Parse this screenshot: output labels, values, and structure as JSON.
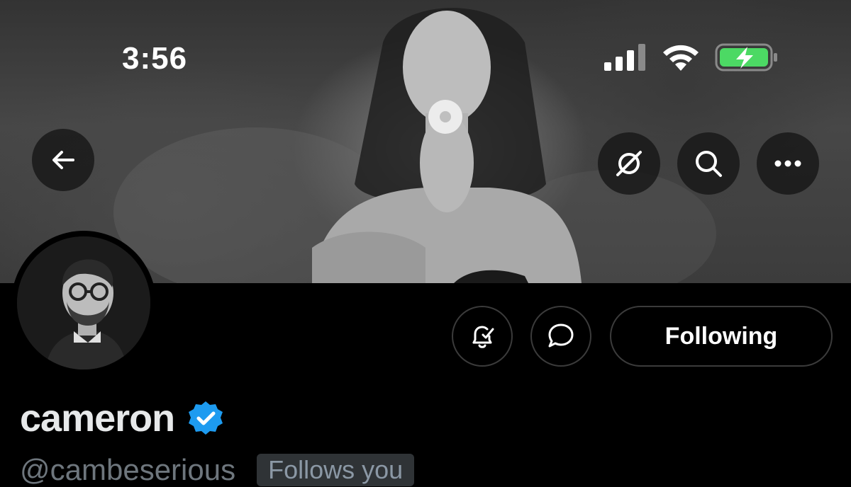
{
  "status_bar": {
    "time": "3:56"
  },
  "header": {
    "back_icon": "arrow-left-icon",
    "grok_icon": "slash-circle-icon",
    "search_icon": "search-icon",
    "more_icon": "ellipsis-icon"
  },
  "profile": {
    "display_name": "cameron",
    "handle": "@cambeserious",
    "follows_you": "Follows you",
    "verified": true,
    "verified_color": "#1d9bf0"
  },
  "actions": {
    "notify_icon": "bell-check-icon",
    "message_icon": "chat-bubble-icon",
    "following_label": "Following"
  },
  "colors": {
    "background": "#000000",
    "battery_charge": "#4cd964",
    "muted_text": "#6e767d"
  }
}
